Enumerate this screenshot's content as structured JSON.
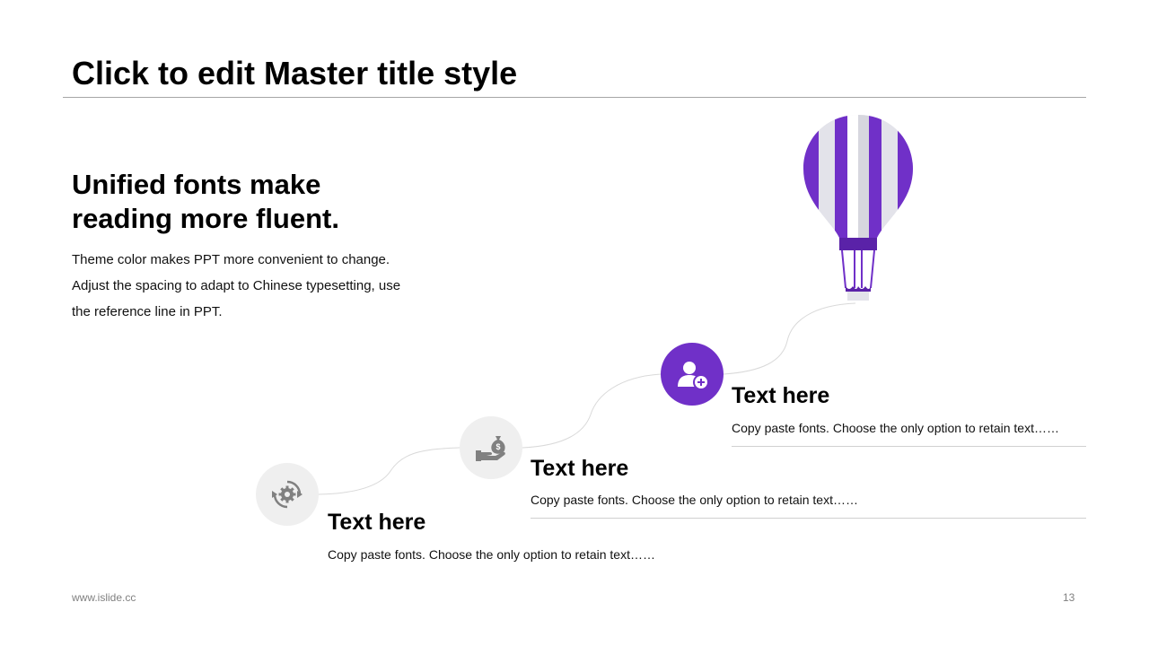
{
  "slide": {
    "master_title": "Click to edit Master title style",
    "headline": {
      "line1": "Unified fonts make",
      "line2": "reading more fluent."
    },
    "body": {
      "line1": "Theme color makes PPT more convenient to change.",
      "line2": "Adjust the spacing to adapt to Chinese typesetting, use",
      "line3": "the reference line in PPT."
    },
    "steps": [
      {
        "title": "Text here",
        "desc": "Copy paste fonts. Choose the only option to retain text……",
        "icon": "gear-refresh-icon",
        "highlighted": false
      },
      {
        "title": "Text here",
        "desc": "Copy paste fonts. Choose the only option to retain text……",
        "icon": "money-bag-hand-icon",
        "highlighted": false
      },
      {
        "title": "Text here",
        "desc": "Copy paste fonts. Choose the only option to retain text……",
        "icon": "user-add-icon",
        "highlighted": true
      }
    ],
    "decoration": "hot-air-balloon-icon",
    "footer": {
      "url": "www.islide.cc",
      "page_number": "13"
    }
  },
  "colors": {
    "accent": "#7030c8",
    "accent_dark": "#5a22a8",
    "icon_gray": "#808080",
    "circle_gray": "#efefef",
    "rule": "#d0d0d0"
  }
}
